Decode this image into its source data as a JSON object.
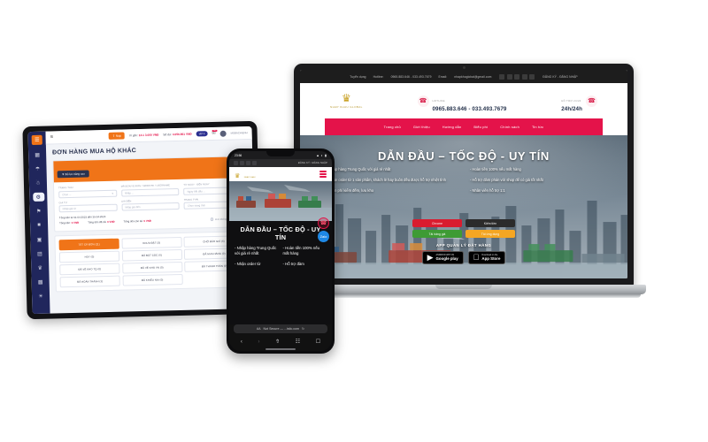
{
  "scene": {
    "background": "#ffffff",
    "accent_red": "#e4134a",
    "accent_orange": "#f07418",
    "sidebar_navy": "#20265c"
  },
  "laptop": {
    "site": {
      "topbar": {
        "left_label": "Tuyển dụng",
        "hotline_label": "Hotline:",
        "hotline": "0965.883.646 - 033.493.7679",
        "email_label": "Email:",
        "email": "nhapkhoglobal@gmail.com",
        "social": [
          "facebook-icon",
          "twitter-icon",
          "youtube-icon",
          "instagram-icon",
          "google-plus-icon"
        ],
        "auth": "ĐĂNG KÝ - ĐĂNG NHẬP"
      },
      "header": {
        "logo_mark": "crown-icon",
        "logo_text": "NHAP KHAU GLOBAL",
        "phone_icon": "phone-icon",
        "phone_label": "HOTLINE",
        "phone_value": "0965.883.646 - 033.493.7679",
        "support_label": "HỖ TRỢ 24/24",
        "support_value": "24h/24h",
        "support_icon": "phone-icon"
      },
      "nav": [
        "Trang chủ",
        "Giới thiệu",
        "Hướng dẫn",
        "Biểu phí",
        "Chính sách",
        "Tin tức"
      ],
      "hero": {
        "title": "DẪN ĐẦU – TỐC ĐỘ - UY TÍN",
        "left_bullets": [
          "- Nhập hàng Trung Quốc với giá rẻ nhất",
          "- Nhận order từ 1 sản phẩm, khách lẻ hay buôn đều được hỗ trợ nhiệt tình",
          "- Miễn phí kiểm đếm, lưu kho"
        ],
        "right_bullets": [
          "- Hoàn tiền 100% nếu mất hàng",
          "- Hỗ trợ đàm phán với shop để có giá tốt nhất",
          "- Nhân viên hỗ trợ 1:1"
        ],
        "buttons": [
          {
            "label": "Chrome",
            "color": "#d91c2f"
          },
          {
            "label": "Kiếm tiền",
            "color": "#2b2b2b"
          },
          {
            "label": "Tải bảng giá",
            "color": "#3e9b34"
          },
          {
            "label": "Tải ứng dụng",
            "color": "#f5a623"
          }
        ],
        "app_title": "APP QUẢN LÝ ĐẶT HÀNG",
        "stores": [
          {
            "icon": "google-play-icon",
            "small": "ANDROID APP ON",
            "big": "Google play"
          },
          {
            "icon": "apple-icon",
            "small": "Download on the",
            "big": "App Store"
          }
        ]
      }
    }
  },
  "tablet": {
    "sidebar": {
      "logo_icon": "app-logo-icon",
      "items": [
        {
          "icon": "dashboard-icon",
          "active": false
        },
        {
          "icon": "cart-icon",
          "active": false
        },
        {
          "icon": "users-icon",
          "active": false
        },
        {
          "icon": "package-icon",
          "active": true
        },
        {
          "icon": "flag-icon",
          "active": false
        },
        {
          "icon": "wallet-icon",
          "active": false
        },
        {
          "icon": "camera-icon",
          "active": false
        },
        {
          "icon": "truck-icon",
          "active": false
        },
        {
          "icon": "crown-icon",
          "active": false
        },
        {
          "icon": "chart-icon",
          "active": false
        },
        {
          "icon": "settings-icon",
          "active": false
        }
      ]
    },
    "topbar": {
      "menu_icon": "hamburger-icon",
      "deposit_label": "Nạp",
      "deposit_icon": "upload-icon",
      "balance_label": "Ví gốc",
      "balance_value": "14.1 3.000 VNĐ",
      "credit_label": "Số dư",
      "credit_value": "4.056.861 VNĐ",
      "vip_badge": "VIP 4",
      "bell_icon": "bell-icon",
      "bell_count": "364",
      "avatar": "user-avatar",
      "username": "MOBACHIENH"
    },
    "page": {
      "title": "ĐƠN HÀNG MUA HỘ KHÁC",
      "filter_button": "Bộ lọc nâng cao",
      "filter_icon": "filter-icon",
      "fields_row1": [
        {
          "label": "TRẠNG THÁI",
          "value": "Chọn ...",
          "caret": "chevron-down-icon"
        },
        {
          "label": "MÃ ĐƠN/ IB ĐƠN / WEBSITE / USERNAME",
          "value": "Nhập ..."
        },
        {
          "label": "TỪ NGÀY - ĐẾN NGÀY",
          "value": "Ngày bắt đầu ..."
        }
      ],
      "fields_row2": [
        {
          "label": "GIÁ TỪ",
          "value": "Nhập giá từ"
        },
        {
          "label": "GIÁ ĐẾN",
          "value": "Nhập giá đến"
        },
        {
          "label": "TRẠNG THÁI",
          "value": "Chọn trạng thái"
        }
      ],
      "totals_range": "Tổng tiền từ 01-04-2023 đến 30-04-2023",
      "totals": [
        {
          "label": "Tổng tiền:",
          "value": "0 VNĐ"
        },
        {
          "label": "Tổng tiền đã trả:",
          "value": "0 VNĐ"
        },
        {
          "label": "Tổng tiền còn lại:",
          "value": "0 VNĐ"
        }
      ],
      "checkbox_label": "Đơn không có mã vận đơn",
      "status_tabs": [
        {
          "label": "TẤT CẢ ĐƠN (11)",
          "active": true
        },
        {
          "label": "CHƯA ĐẶT (3)",
          "active": false
        },
        {
          "label": "CHỜ BÁO GIÁ (6)",
          "active": false
        },
        {
          "label": "HỦY (0)",
          "active": false
        },
        {
          "label": "ĐÃ ĐẶT CỌC (0)",
          "active": false
        },
        {
          "label": "ĐÃ MUA HÀNG (0)",
          "active": false
        },
        {
          "label": "ĐÃ VỀ KHO TQ (0)",
          "active": false
        },
        {
          "label": "ĐÃ VỀ KHO VN (0)",
          "active": false
        },
        {
          "label": "ĐÃ THANH TOÁN (0)",
          "active": false
        },
        {
          "label": "ĐÃ HOÀN THÀNH (1)",
          "active": false
        },
        {
          "label": "ĐÃ KHIẾU NẠI (0)",
          "active": false
        }
      ]
    }
  },
  "phone": {
    "status": {
      "time": "23:56",
      "signal_icon": "signal-icon",
      "wifi_icon": "wifi-icon",
      "battery_icon": "battery-icon"
    },
    "topbar": {
      "social": [
        "facebook-icon",
        "twitter-icon",
        "youtube-icon",
        "instagram-icon"
      ],
      "auth": "ĐĂNG KÝ / ĐĂNG NHẬP"
    },
    "header": {
      "logo_mark": "crown-icon",
      "logo_text": "NHAP KHAU",
      "menu_icon": "hamburger-icon"
    },
    "hero": {
      "title": "DẪN ĐẦU – TỐC ĐỘ - UY TÍN",
      "col_left": [
        "- Nhập hàng Trung Quốc với giá rẻ nhất",
        "- Nhận order từ"
      ],
      "col_right": [
        "- Hoàn tiền 100% nếu mất hàng",
        "- Hỗ trợ đàm"
      ],
      "float_call": "phone-icon",
      "float_zalo": "zalo-icon"
    },
    "browser": {
      "aa_label": "AA",
      "url": "Not Secure — ...istic.com",
      "reload_icon": "reload-icon",
      "nav": [
        "back-icon",
        "forward-icon",
        "share-icon",
        "bookmarks-icon",
        "tabs-icon"
      ]
    }
  }
}
